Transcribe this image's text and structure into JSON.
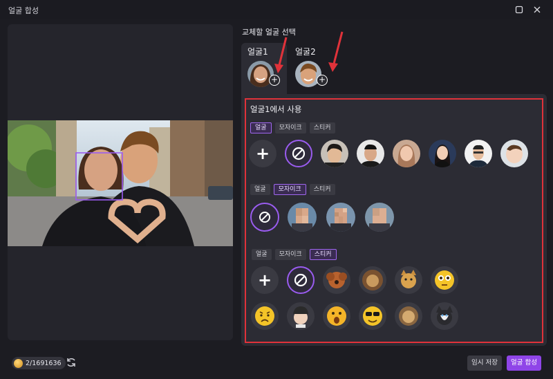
{
  "window": {
    "title": "얼굴 합성"
  },
  "select_section": {
    "label": "교체할 얼굴 선택",
    "faces": [
      {
        "label": "얼굴1"
      },
      {
        "label": "얼굴2"
      }
    ]
  },
  "apply_section": {
    "title": "얼굴1에서 사용",
    "tabs": [
      "얼굴",
      "모자이크",
      "스티커"
    ],
    "rows": [
      {
        "active_tab": "얼굴",
        "items": [
          "add",
          "none",
          "face-man-1",
          "face-man-2",
          "face-woman-1",
          "face-woman-2",
          "face-man-glasses",
          "face-baby"
        ]
      },
      {
        "active_tab": "모자이크",
        "items": [
          "none",
          "mosaic-1",
          "mosaic-2",
          "mosaic-3"
        ]
      },
      {
        "active_tab": "스티커",
        "items": [
          "add",
          "none",
          "dog-sticker",
          "lion-sticker",
          "cat-sticker",
          "flushed-emoji-sticker",
          "worried-emoji-sticker",
          "cartoon-boy-sticker",
          "surprised-emoji-sticker",
          "sunglasses-emoji-sticker",
          "lion-sticker-2",
          "husky-sticker"
        ]
      }
    ]
  },
  "footer": {
    "credits": "2/1691636",
    "save_draft": "임시 저장",
    "merge": "얼굴 합성"
  },
  "colors": {
    "accent": "#8f45e8",
    "highlight_frame": "#e0323a",
    "arrow": "#e0323a"
  }
}
